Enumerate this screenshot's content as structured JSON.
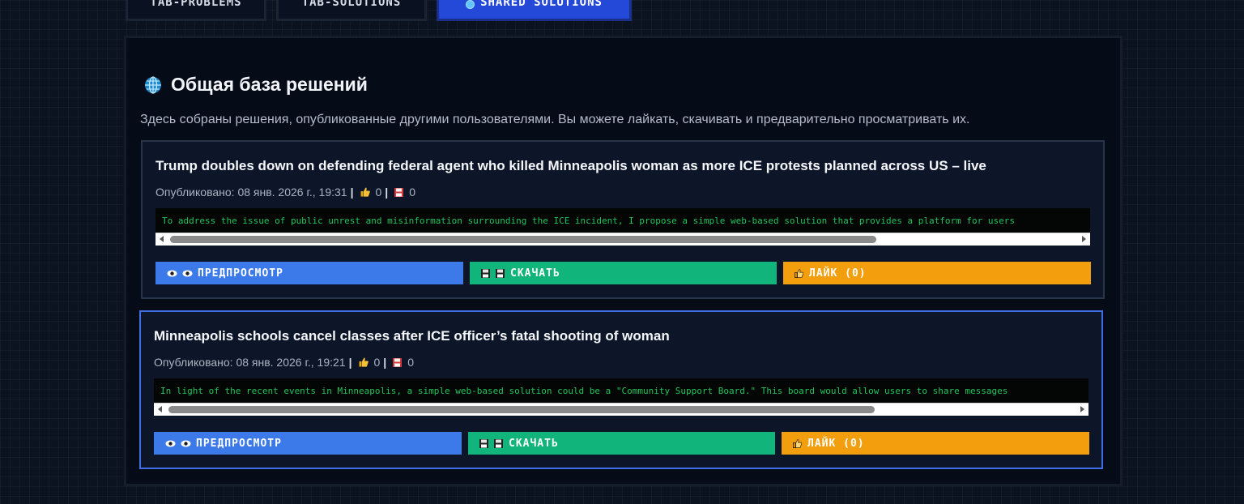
{
  "tabs": [
    {
      "label": "TAB-PROBLEMS",
      "active": false
    },
    {
      "label": "TAB-SOLUTIONS",
      "active": false
    },
    {
      "label": "SHARED SOLUTIONS",
      "active": true
    }
  ],
  "panel": {
    "title": "Общая база решений",
    "description": "Здесь собраны решения, опубликованные другими пользователями. Вы можете лайкать, скачивать и предварительно просматривать их."
  },
  "solutions": [
    {
      "title": "Trump doubles down on defending federal agent who killed Minneapolis woman as more ICE protests planned across US – live",
      "published": "Опубликовано: 08 янв. 2026 г., 19:31",
      "likes": "0",
      "downloads": "0",
      "code": "To address the issue of public unrest and misinformation surrounding the ICE incident, I propose a simple web-based solution that provides a platform for users",
      "preview_label": "ПРЕДПРОСМОТР",
      "download_label": "СКАЧАТЬ",
      "like_label": "ЛАЙК (0)",
      "selected": false
    },
    {
      "title": "Minneapolis schools cancel classes after ICE officer’s fatal shooting of woman",
      "published": "Опубликовано: 08 янв. 2026 г., 19:21",
      "likes": "0",
      "downloads": "0",
      "code": "In light of the recent events in Minneapolis, a simple web-based solution could be a \"Community Support Board.\" This board would allow users to share messages",
      "preview_label": "ПРЕДПРОСМОТР",
      "download_label": "СКАЧАТЬ",
      "like_label": "ЛАЙК (0)",
      "selected": true
    }
  ],
  "icons": {
    "heading": "globe-icon",
    "likes": "thumbs-up-icon",
    "downloads": "floppy-disk-icon",
    "preview": "eye-icon",
    "like": "thumbs-up-icon"
  },
  "colors": {
    "active_tab": "#2449d8",
    "preview_button": "#3b7ae8",
    "download_button": "#11b47b",
    "like_button": "#f29e0d",
    "selected_border": "#3f6ee6",
    "code_text": "#21c45a"
  }
}
